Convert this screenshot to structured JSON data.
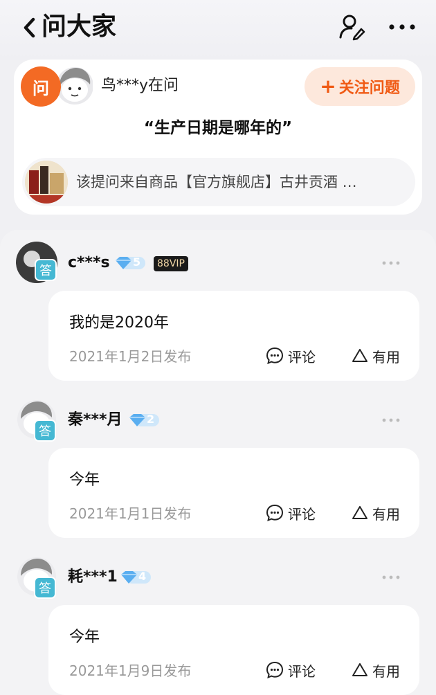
{
  "header": {
    "back_icon": "chevron-left-icon",
    "title": "问大家",
    "user_edit_icon": "user-edit-icon",
    "more_icon": "more-dots-icon"
  },
  "question": {
    "badge": "问",
    "asker": "鸟***y在问",
    "follow_label": "关注问题",
    "follow_plus": "+",
    "text": "“生产日期是哪年的”",
    "source_text": "该提问来自商品【官方旗舰店】古井贡酒 …"
  },
  "answers": [
    {
      "name": "c***s",
      "tag": "答",
      "level": "5",
      "vip": "88VIP",
      "text": "我的是2020年",
      "date": "2021年1月2日发布",
      "comment_label": "评论",
      "useful_label": "有用"
    },
    {
      "name": "秦***月",
      "tag": "答",
      "level": "2",
      "text": "今年",
      "date": "2021年1月1日发布",
      "comment_label": "评论",
      "useful_label": "有用"
    },
    {
      "name": "耗***1",
      "tag": "答",
      "level": "4",
      "text": "今年",
      "date": "2021年1月9日发布",
      "comment_label": "评论",
      "useful_label": "有用"
    }
  ],
  "colors": {
    "accent_orange": "#f36a24",
    "follow_bg": "#fde8dc",
    "answer_tag": "#45b8d3",
    "level_blue": "#6fb9f2"
  }
}
